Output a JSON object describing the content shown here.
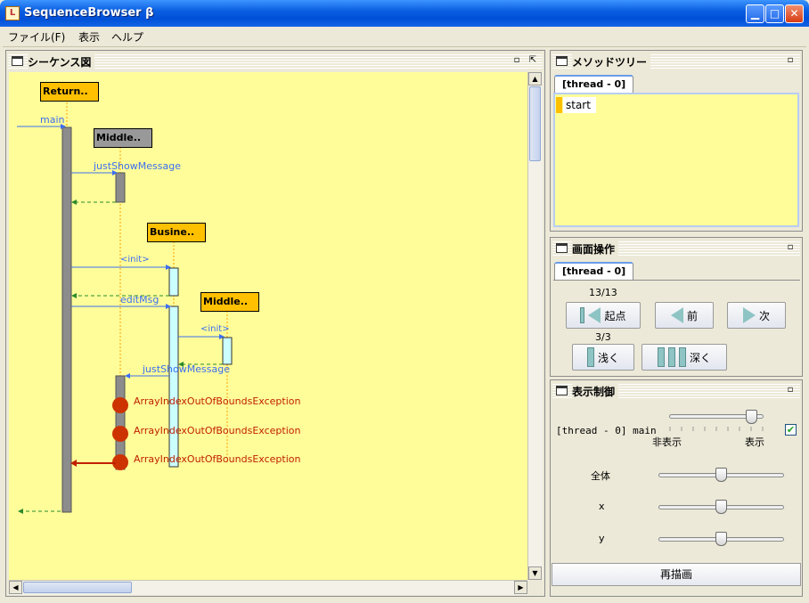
{
  "window": {
    "title": "SequenceBrowser β",
    "icon": "app-icon",
    "controls": [
      "minimize",
      "maximize",
      "close"
    ]
  },
  "menu": {
    "items": [
      "ファイル(F)",
      "表示",
      "ヘルプ"
    ]
  },
  "sequence_panel": {
    "title": "シーケンス図",
    "lifelines": [
      "Return..",
      "Middle..",
      "Busine..",
      "Middle.."
    ],
    "messages": [
      "main",
      "justShowMessage",
      "<init>",
      "editMsg",
      "<init>",
      "justShowMessage"
    ],
    "exceptions": [
      "ArrayIndexOutOfBoundsException",
      "ArrayIndexOutOfBoundsException",
      "ArrayIndexOutOfBoundsException"
    ]
  },
  "method_tree_panel": {
    "title": "メソッドツリー",
    "tab": "[thread - 0]",
    "items": [
      "start"
    ]
  },
  "screen_ops_panel": {
    "title": "画面操作",
    "tab": "[thread - 0]",
    "step_counter": "13/13",
    "depth_counter": "3/3",
    "start_button": "起点",
    "prev_button": "前",
    "next_button": "次",
    "shallow_button": "浅く",
    "deep_button": "深く"
  },
  "display_control_panel": {
    "title": "表示制御",
    "thread_label": "[thread - 0] main",
    "hide_label": "非表示",
    "show_label": "表示",
    "thread_visible": true,
    "thread_slider_value": 0.92,
    "zoom_all_label": "全体",
    "zoom_all_value": 0.5,
    "x_label": "x",
    "x_value": 0.5,
    "y_label": "y",
    "y_value": 0.5,
    "redraw_button": "再描画"
  },
  "colors": {
    "diagram_bg": "#fffd99",
    "active_lifeline": "#ffc000",
    "inactive_lifeline": "#999999",
    "message": "#3c6ef0",
    "return": "#2a8a2a",
    "exception": "#c02000"
  }
}
